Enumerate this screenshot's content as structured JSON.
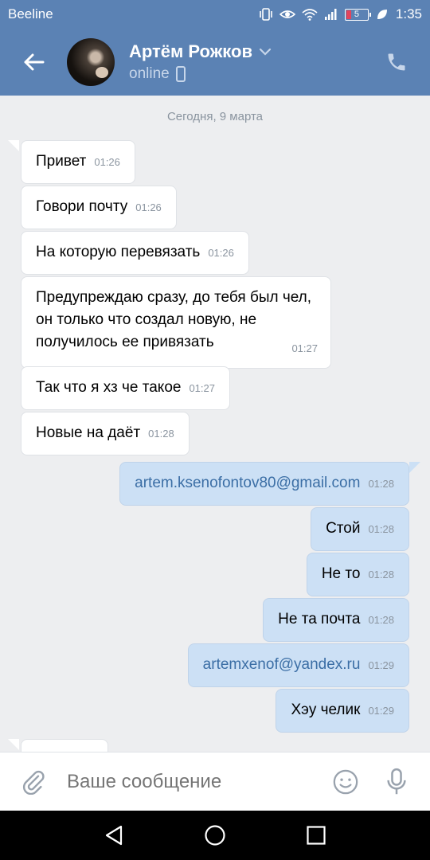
{
  "status_bar": {
    "carrier": "Beeline",
    "battery_level": "5",
    "time": "1:35"
  },
  "header": {
    "contact_name": "Артём Рожков",
    "status": "online"
  },
  "date_separator": "Сегодня, 9 марта",
  "messages": [
    {
      "direction": "in",
      "text": "Привет",
      "time": "01:26"
    },
    {
      "direction": "in",
      "text": "Говори почту",
      "time": "01:26"
    },
    {
      "direction": "in",
      "text": "На которую перевязать",
      "time": "01:26"
    },
    {
      "direction": "in",
      "text": "Предупреждаю сразу, до тебя был чел, он только что создал новую, не получилось ее привязать",
      "time": "01:27"
    },
    {
      "direction": "in",
      "text": "Так что я хз че такое",
      "time": "01:27"
    },
    {
      "direction": "in",
      "text": "Новые на даёт",
      "time": "01:28"
    },
    {
      "direction": "out",
      "text": "artem.ksenofontov80@gmail.com",
      "time": "01:28"
    },
    {
      "direction": "out",
      "text": "Стой",
      "time": "01:28"
    },
    {
      "direction": "out",
      "text": "Не то",
      "time": "01:28"
    },
    {
      "direction": "out",
      "text": "Не та почта",
      "time": "01:28"
    },
    {
      "direction": "out",
      "text": "artemxenof@yandex.ru",
      "time": "01:29"
    },
    {
      "direction": "out",
      "text": "Хэу челик",
      "time": "01:29"
    }
  ],
  "composer": {
    "placeholder": "Ваше сообщение"
  },
  "colors": {
    "header": "#5b82b4",
    "incoming_bubble": "#ffffff",
    "outgoing_bubble": "#cce0f5",
    "link": "#3b6ea5"
  }
}
